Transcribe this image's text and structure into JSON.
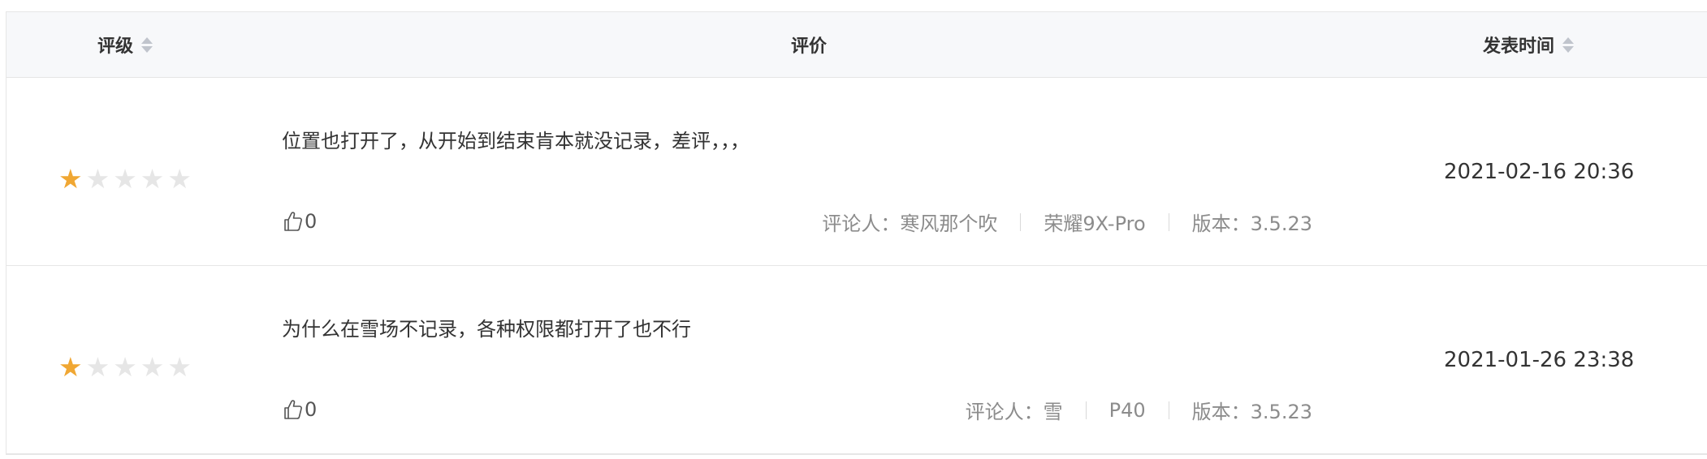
{
  "header": {
    "rating_label": "评级",
    "review_label": "评价",
    "time_label": "发表时间"
  },
  "reviews": [
    {
      "stars": 1,
      "max_stars": 5,
      "text": "位置也打开了，从开始到结束肯本就没记录，差评，，，",
      "likes": "0",
      "reviewer": "评论人：寒风那个吹",
      "device": "荣耀9X-Pro",
      "version": "版本：3.5.23",
      "time": "2021-02-16 20:36"
    },
    {
      "stars": 1,
      "max_stars": 5,
      "text": "为什么在雪场不记录，各种权限都打开了也不行",
      "likes": "0",
      "reviewer": "评论人：雪",
      "device": "P40",
      "version": "版本：3.5.23",
      "time": "2021-01-26 23:38"
    }
  ],
  "colors": {
    "star_on": "#f0a733",
    "star_off": "#e6e6e6",
    "header_bg": "#f7f8fa"
  },
  "icons": {
    "star": "star-icon",
    "like": "thumbs-up-icon",
    "sort": "sort-icon"
  }
}
